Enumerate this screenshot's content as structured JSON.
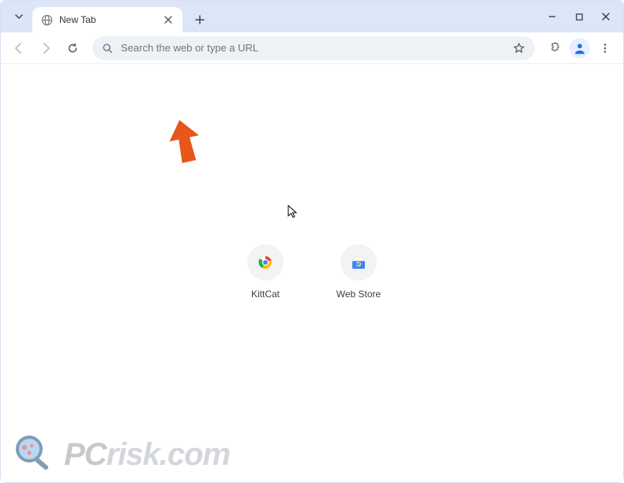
{
  "tab": {
    "title": "New Tab"
  },
  "omnibox": {
    "placeholder": "Search the web or type a URL"
  },
  "shortcuts": [
    {
      "label": "KittCat"
    },
    {
      "label": "Web Store"
    }
  ],
  "watermark": {
    "pc": "PC",
    "risk": "risk.com"
  }
}
